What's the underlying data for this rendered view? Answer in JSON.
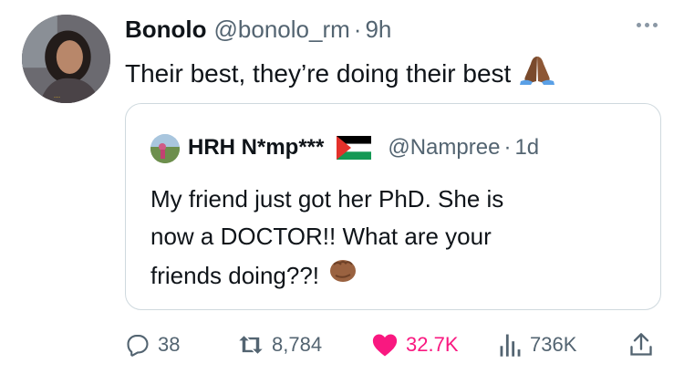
{
  "author": {
    "name": "Bonolo",
    "handle": "@bonolo_rm",
    "separator": "·",
    "time": "9h"
  },
  "tweet": {
    "text": "Their best, they’re doing their best",
    "emoji": "folded-hands"
  },
  "quote": {
    "author": {
      "name": "HRH N*mp***",
      "flag": "palestine-flag",
      "handle": "@Nampree",
      "separator": "·",
      "time": "1d"
    },
    "lines": [
      "My friend just got her PhD. She is",
      "now a DOCTOR!! What are your",
      "friends doing??!"
    ],
    "emoji": "oncoming-fist"
  },
  "actions": {
    "reply": {
      "count": "38",
      "icon": "reply-icon"
    },
    "retweet": {
      "count": "8,784",
      "icon": "retweet-icon"
    },
    "like": {
      "count": "32.7K",
      "icon": "heart-icon",
      "liked": true,
      "color": "#f91880"
    },
    "views": {
      "count": "736K",
      "icon": "views-icon"
    },
    "share": {
      "icon": "share-icon"
    }
  },
  "colors": {
    "text_primary": "#0f1419",
    "text_secondary": "#536471",
    "border": "#cfd9de",
    "like": "#f91880"
  }
}
